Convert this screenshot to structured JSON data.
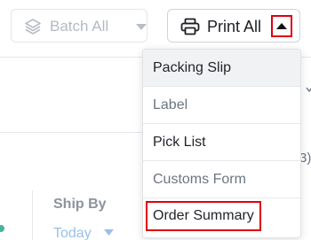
{
  "toolbar": {
    "batch_label": "Batch All",
    "print_label": "Print All"
  },
  "menu": {
    "items": [
      {
        "label": "Packing Slip"
      },
      {
        "label": "Label"
      },
      {
        "label": "Pick List"
      },
      {
        "label": "Customs Form"
      },
      {
        "label": "Order Summary"
      }
    ]
  },
  "background": {
    "partial_text": "3)",
    "column_header": "Ship By",
    "filter_value": "Today"
  },
  "colors": {
    "highlight": "#e00010",
    "filter_link": "#9ac0e8",
    "status_dot": "#46b39a"
  }
}
